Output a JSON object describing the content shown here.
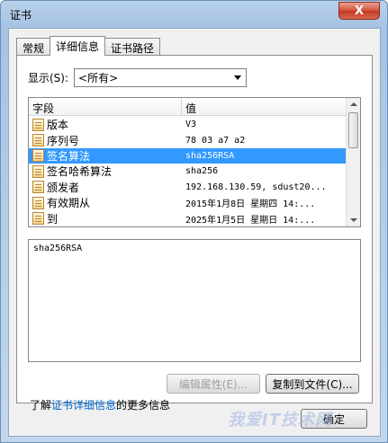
{
  "window": {
    "title": "证书",
    "close_glyph": "X"
  },
  "tabs": [
    {
      "label": "常规"
    },
    {
      "label": "详细信息",
      "active": true
    },
    {
      "label": "证书路径"
    }
  ],
  "show": {
    "label": "显示(S):",
    "selected": "<所有>"
  },
  "list": {
    "headers": {
      "field": "字段",
      "value": "值"
    },
    "rows": [
      {
        "field": "版本",
        "value": "V3"
      },
      {
        "field": "序列号",
        "value": "78 03 a7 a2"
      },
      {
        "field": "签名算法",
        "value": "sha256RSA",
        "selected": true
      },
      {
        "field": "签名哈希算法",
        "value": "sha256"
      },
      {
        "field": "颁发者",
        "value": "192.168.130.59, sdust20..."
      },
      {
        "field": "有效期从",
        "value": "2015年1月8日 星期四 14:..."
      },
      {
        "field": "到",
        "value": "2025年1月5日 星期日 14:..."
      }
    ]
  },
  "detail_text": "sha256RSA",
  "buttons": {
    "edit_properties": "编辑属性(E)...",
    "copy_to_file": "复制到文件(C)...",
    "ok": "确定"
  },
  "learn_more": {
    "prefix": "了解",
    "link": "证书详细信息",
    "suffix": "的更多信息"
  },
  "watermark": "我爱IT技术网"
}
